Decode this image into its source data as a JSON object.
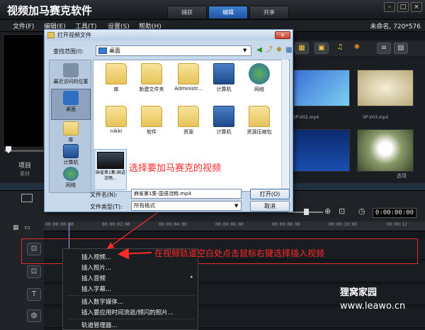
{
  "app": {
    "title": "视频加马赛克软件",
    "tabs": [
      {
        "label": "捕获"
      },
      {
        "label": "编辑"
      },
      {
        "label": "共享"
      }
    ],
    "project_info": "未命名, 720*576"
  },
  "menu": {
    "items": [
      {
        "label": "文件(F)"
      },
      {
        "label": "编辑(E)"
      },
      {
        "label": "工具(T)"
      },
      {
        "label": "设置(S)"
      },
      {
        "label": "帮助(H)"
      }
    ]
  },
  "left_panel": {
    "project_label": "项目",
    "material_label": "素材"
  },
  "library": {
    "thumb_captions": [
      "SP-V02.mp4",
      "SP-V03.mp4"
    ],
    "options_label": "选项"
  },
  "timeline": {
    "timecode": "0:00:00:00",
    "ruler_ticks": [
      "00:00:00:00",
      "00:00:02:00",
      "00:00:04:00",
      "00:00:06:00",
      "00:00:08:00",
      "00:00:10:00",
      "00:00:12"
    ]
  },
  "dialog": {
    "title": "打开视频文件",
    "look_in_label": "查找范围(I):",
    "look_in_value": "桌面",
    "places": [
      {
        "label": "最近访问的位置"
      },
      {
        "label": "桌面"
      },
      {
        "label": "库"
      },
      {
        "label": "计算机"
      },
      {
        "label": "网络"
      }
    ],
    "files": [
      {
        "label": "库",
        "icon": "library-icon"
      },
      {
        "label": "新建文件夹",
        "icon": "folder-icon"
      },
      {
        "label": "Administr...",
        "icon": "user-folder-icon"
      },
      {
        "label": "计算机",
        "icon": "computer-icon"
      },
      {
        "label": "网络",
        "icon": "network-icon"
      },
      {
        "label": "nikki",
        "icon": "folder-icon"
      },
      {
        "label": "软件",
        "icon": "folder-icon"
      },
      {
        "label": "资源",
        "icon": "folder-icon"
      },
      {
        "label": "计算机",
        "icon": "computer-shortcut-icon"
      },
      {
        "label": "资源压缩包",
        "icon": "folder-shortcut-icon"
      }
    ],
    "video_file": {
      "label": "麻雀第1集-国语流畅..."
    },
    "filename_label": "文件名(N):",
    "filename_value": "麻雀第1集-国语流畅.mp4",
    "filetype_label": "文件类型(T):",
    "filetype_value": "所有格式",
    "open_label": "打开(O)",
    "cancel_label": "取消"
  },
  "context_menu": {
    "items": [
      {
        "label": "插入视频..."
      },
      {
        "label": "插入照片..."
      },
      {
        "label": "插入音频"
      },
      {
        "label": "插入字幕..."
      },
      {
        "label": "插入数字媒体..."
      },
      {
        "label": "插入要应用时间流逝/频闪的照片..."
      },
      {
        "label": "轨道管理器..."
      }
    ]
  },
  "annotations": {
    "select_video": "选择要加马赛克的视频",
    "right_click_hint": "在视频轨道空白处点击鼠标右键选择插入视频"
  },
  "watermark": {
    "brand": "狸窝家园",
    "url": "www.leawo.cn"
  },
  "colors": {
    "annotation": "#ff2a2a",
    "accent": "#1d55a4"
  }
}
